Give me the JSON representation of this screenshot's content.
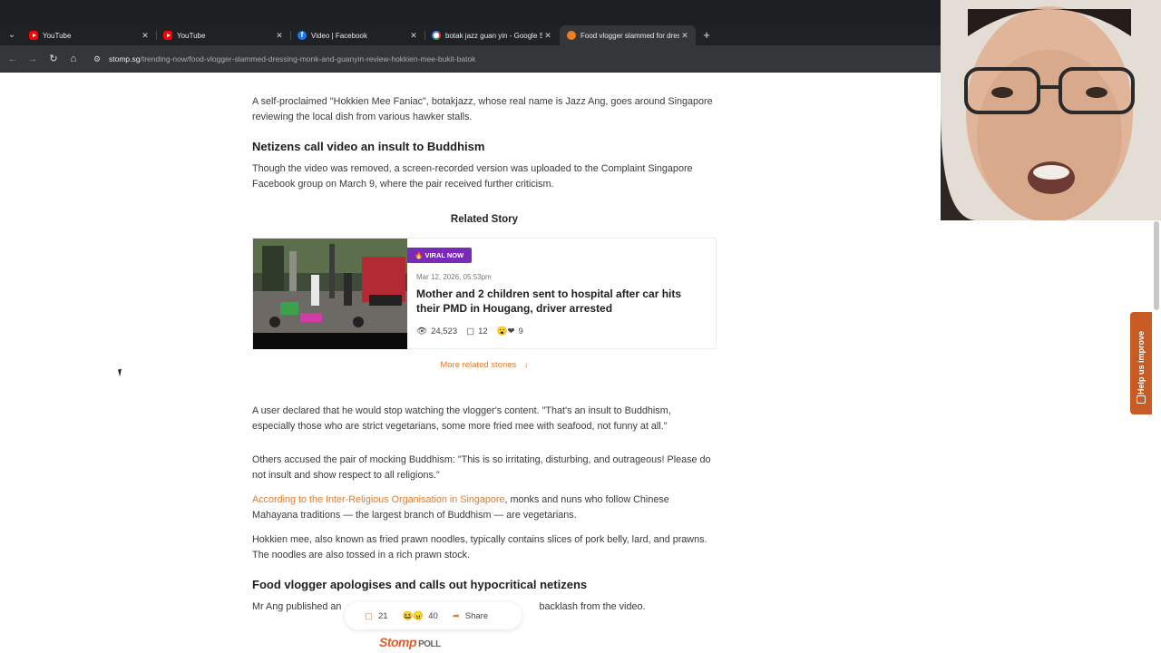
{
  "browser": {
    "tabs": [
      {
        "title": "YouTube",
        "favicon": "youtube-icon",
        "active": false
      },
      {
        "title": "YouTube",
        "favicon": "youtube-icon",
        "active": false
      },
      {
        "title": "Video | Facebook",
        "favicon": "facebook-icon",
        "active": false
      },
      {
        "title": "botak jazz guan yin - Google Se",
        "favicon": "google-icon",
        "active": false
      },
      {
        "title": "Food vlogger slammed for dres",
        "favicon": "stomp-icon",
        "active": true
      }
    ],
    "url_host": "stomp.sg",
    "url_path": "/trending-now/food-vlogger-slammed-dressing-monk-and-guanyin-review-hokkien-mee-bukit-batok"
  },
  "article": {
    "para1": "A self-proclaimed \"Hokkien Mee Faniac\", botakjazz, whose real name is Jazz Ang, goes around Singapore reviewing the local dish from various hawker stalls.",
    "heading1": "Netizens call video an insult to Buddhism",
    "para2": "Though the video was removed, a screen-recorded version was uploaded to the Complaint Singapore Facebook group on March 9, where the pair received further criticism.",
    "para3": "A user declared that he would stop watching the vlogger's content. \"That's an insult to Buddhism, especially those who are strict vegetarians, some more fried mee with seafood, not funny at all.\"",
    "para4": "Others accused the pair of mocking Buddhism: \"This is so irritating, disturbing, and outrageous! Please do not insult and show respect to all religions.\"",
    "para5_link": "According to the Inter-Religious Organisation in Singapore",
    "para5_rest": ", monks and nuns who follow Chinese Mahayana traditions — the largest branch of Buddhism — are vegetarians.",
    "para6": "Hokkien mee, also known as fried prawn noodles, typically contains slices of pork belly, lard, and prawns. The noodles are also tossed in a rich prawn stock.",
    "heading2": "Food vlogger apologises and calls out hypocritical netizens",
    "para7_start": "Mr Ang published an",
    "para7_end": "backlash from the video."
  },
  "related": {
    "section_title": "Related Story",
    "badge": "VIRAL NOW",
    "date": "Mar 12, 2026, 05:53pm",
    "title": "Mother and 2 children sent to hospital after car hits their PMD in Hougang, driver arrested",
    "views": "24,523",
    "comments": "12",
    "reactions": "9",
    "more_label": "More related stories",
    "more_arrow": "↓"
  },
  "sticky_bar": {
    "comments": "21",
    "reactions": "40",
    "share_label": "Share"
  },
  "poll": {
    "brand": "Stomp",
    "label": "POLL"
  },
  "feedback": {
    "label": "Help us improve"
  },
  "colors": {
    "accent": "#e07b2e",
    "badge": "#7a29b8",
    "feedback": "#c85a24"
  }
}
